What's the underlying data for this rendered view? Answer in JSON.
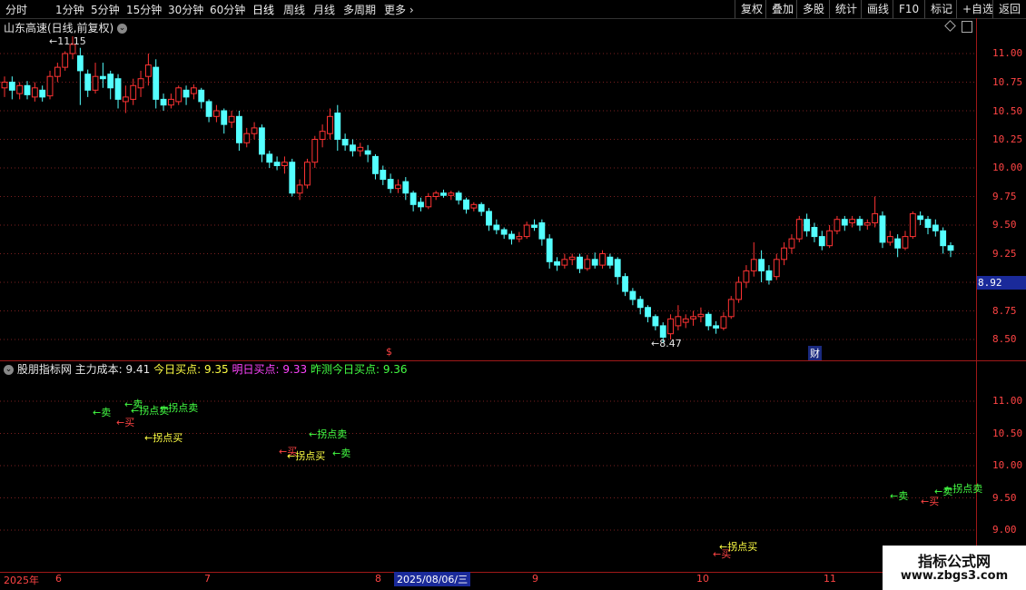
{
  "toolbar": {
    "left": [
      "分时",
      "1分钟",
      "5分钟",
      "15分钟",
      "30分钟",
      "60分钟",
      "日线",
      "周线",
      "月线",
      "多周期",
      "更多"
    ],
    "active": "日线",
    "right": [
      "复权",
      "叠加",
      "多股",
      "统计",
      "画线",
      "F10",
      "标记",
      "+自选",
      "返回"
    ]
  },
  "main_panel": {
    "title": "山东高速(日线,前复权)",
    "high_label": "11.15",
    "low_label": "8.47",
    "current_price": "8.92",
    "marker_dollar": "$",
    "marker_cai": "财",
    "y_ticks": [
      "11.00",
      "10.75",
      "10.50",
      "10.25",
      "10.00",
      "9.75",
      "9.50",
      "9.25",
      "9.00",
      "8.75",
      "8.50"
    ]
  },
  "indicator_panel": {
    "name": "股朋指标网",
    "items": [
      {
        "label": "主力成本:",
        "value": "9.41",
        "color": "#e6e6e6"
      },
      {
        "label": "今日买点:",
        "value": "9.35",
        "color": "#ffff44"
      },
      {
        "label": "明日买点:",
        "value": "9.33",
        "color": "#ff44ff"
      },
      {
        "label": "昨测今日买点:",
        "value": "9.36",
        "color": "#44ff44"
      }
    ],
    "y_ticks": [
      "11.00",
      "10.50",
      "10.00",
      "9.50",
      "9.00"
    ],
    "signals": [
      {
        "text": "←卖",
        "color": "#44ff44"
      },
      {
        "text": "←卖",
        "color": "#44ff44"
      },
      {
        "text": "←拐点卖",
        "color": "#44ff44"
      },
      {
        "text": "←拐点卖",
        "color": "#44ff44"
      },
      {
        "text": "←买",
        "color": "#ff4444"
      },
      {
        "text": "←拐点买",
        "color": "#ffff44"
      },
      {
        "text": "←拐点卖",
        "color": "#44ff44"
      },
      {
        "text": "←买",
        "color": "#ff4444"
      },
      {
        "text": "←拐点买",
        "color": "#ffff44"
      },
      {
        "text": "←卖",
        "color": "#44ff44"
      },
      {
        "text": "←卖",
        "color": "#44ff44"
      },
      {
        "text": "←买",
        "color": "#ff4444"
      },
      {
        "text": "←卖",
        "color": "#44ff44"
      },
      {
        "text": "←拐点卖",
        "color": "#44ff44"
      },
      {
        "text": "←买",
        "color": "#ff4444"
      },
      {
        "text": "←拐点买",
        "color": "#ffff44"
      }
    ]
  },
  "date_axis": {
    "labels": [
      "2025年",
      "6",
      "7",
      "8",
      "9",
      "10",
      "11"
    ],
    "cursor_date": "2025/08/06/三"
  },
  "watermark": {
    "title": "指标公式网",
    "url": "www.zbgs3.com"
  },
  "colors": {
    "up": "#ff3333",
    "down": "#54ffff",
    "grid": "#7a1f1f",
    "axis_text": "#ff4444"
  },
  "chart_data": {
    "type": "candlestick",
    "ylim": [
      8.4,
      11.3
    ],
    "candles": [
      [
        10.7,
        10.75,
        10.62,
        10.8
      ],
      [
        10.75,
        10.68,
        10.6,
        10.8
      ],
      [
        10.65,
        10.72,
        10.6,
        10.75
      ],
      [
        10.72,
        10.64,
        10.6,
        10.76
      ],
      [
        10.62,
        10.7,
        10.58,
        10.75
      ],
      [
        10.68,
        10.62,
        10.58,
        10.72
      ],
      [
        10.63,
        10.8,
        10.6,
        10.85
      ],
      [
        10.8,
        10.88,
        10.75,
        10.92
      ],
      [
        10.88,
        11.0,
        10.85,
        11.02
      ],
      [
        11.0,
        11.08,
        10.95,
        11.15
      ],
      [
        10.98,
        10.85,
        10.55,
        11.05
      ],
      [
        10.82,
        10.68,
        10.62,
        10.86
      ],
      [
        10.68,
        10.8,
        10.65,
        10.92
      ],
      [
        10.8,
        10.78,
        10.7,
        10.92
      ],
      [
        10.82,
        10.7,
        10.6,
        10.85
      ],
      [
        10.78,
        10.6,
        10.52,
        10.82
      ],
      [
        10.58,
        10.62,
        10.48,
        10.72
      ],
      [
        10.6,
        10.72,
        10.55,
        10.78
      ],
      [
        10.7,
        10.78,
        10.62,
        10.85
      ],
      [
        10.8,
        10.9,
        10.72,
        11.0
      ],
      [
        10.88,
        10.6,
        10.52,
        10.95
      ],
      [
        10.6,
        10.55,
        10.5,
        10.65
      ],
      [
        10.55,
        10.6,
        10.52,
        10.65
      ],
      [
        10.58,
        10.7,
        10.55,
        10.72
      ],
      [
        10.68,
        10.62,
        10.55,
        10.72
      ],
      [
        10.65,
        10.7,
        10.6,
        10.73
      ],
      [
        10.68,
        10.58,
        10.52,
        10.7
      ],
      [
        10.58,
        10.45,
        10.4,
        10.6
      ],
      [
        10.45,
        10.5,
        10.4,
        10.55
      ],
      [
        10.5,
        10.38,
        10.3,
        10.52
      ],
      [
        10.4,
        10.45,
        10.35,
        10.5
      ],
      [
        10.45,
        10.22,
        10.15,
        10.5
      ],
      [
        10.22,
        10.3,
        10.18,
        10.35
      ],
      [
        10.3,
        10.35,
        10.25,
        10.4
      ],
      [
        10.35,
        10.12,
        10.05,
        10.38
      ],
      [
        10.12,
        10.05,
        10.0,
        10.15
      ],
      [
        10.05,
        10.02,
        9.98,
        10.1
      ],
      [
        10.02,
        10.05,
        9.95,
        10.1
      ],
      [
        10.05,
        9.78,
        9.75,
        10.08
      ],
      [
        9.78,
        9.85,
        9.72,
        9.9
      ],
      [
        9.85,
        10.05,
        9.82,
        10.08
      ],
      [
        10.05,
        10.25,
        10.0,
        10.28
      ],
      [
        10.25,
        10.32,
        10.18,
        10.38
      ],
      [
        10.3,
        10.45,
        10.25,
        10.52
      ],
      [
        10.48,
        10.25,
        10.15,
        10.55
      ],
      [
        10.25,
        10.2,
        10.15,
        10.3
      ],
      [
        10.2,
        10.15,
        10.1,
        10.25
      ],
      [
        10.15,
        10.18,
        10.1,
        10.22
      ],
      [
        10.15,
        10.12,
        10.05,
        10.2
      ],
      [
        10.1,
        9.95,
        9.9,
        10.12
      ],
      [
        9.98,
        9.9,
        9.85,
        10.02
      ],
      [
        9.9,
        9.82,
        9.78,
        9.95
      ],
      [
        9.82,
        9.85,
        9.78,
        9.9
      ],
      [
        9.88,
        9.78,
        9.72,
        9.92
      ],
      [
        9.78,
        9.68,
        9.62,
        9.8
      ],
      [
        9.7,
        9.66,
        9.62,
        9.74
      ],
      [
        9.66,
        9.75,
        9.64,
        9.78
      ],
      [
        9.75,
        9.78,
        9.72,
        9.8
      ],
      [
        9.78,
        9.76,
        9.74,
        9.81
      ],
      [
        9.76,
        9.78,
        9.72,
        9.8
      ],
      [
        9.78,
        9.72,
        9.68,
        9.8
      ],
      [
        9.72,
        9.64,
        9.6,
        9.74
      ],
      [
        9.65,
        9.68,
        9.62,
        9.7
      ],
      [
        9.68,
        9.62,
        9.58,
        9.7
      ],
      [
        9.62,
        9.5,
        9.45,
        9.65
      ],
      [
        9.5,
        9.46,
        9.42,
        9.55
      ],
      [
        9.46,
        9.42,
        9.38,
        9.48
      ],
      [
        9.42,
        9.38,
        9.33,
        9.45
      ],
      [
        9.38,
        9.4,
        9.35,
        9.44
      ],
      [
        9.4,
        9.5,
        9.38,
        9.53
      ],
      [
        9.5,
        9.48,
        9.45,
        9.55
      ],
      [
        9.52,
        9.38,
        9.32,
        9.55
      ],
      [
        9.38,
        9.18,
        9.12,
        9.42
      ],
      [
        9.18,
        9.15,
        9.1,
        9.22
      ],
      [
        9.15,
        9.2,
        9.12,
        9.25
      ],
      [
        9.2,
        9.22,
        9.15,
        9.25
      ],
      [
        9.22,
        9.12,
        9.08,
        9.25
      ],
      [
        9.12,
        9.2,
        9.1,
        9.24
      ],
      [
        9.2,
        9.15,
        9.12,
        9.26
      ],
      [
        9.15,
        9.25,
        9.12,
        9.28
      ],
      [
        9.22,
        9.15,
        9.12,
        9.25
      ],
      [
        9.2,
        9.05,
        8.98,
        9.22
      ],
      [
        9.05,
        8.92,
        8.88,
        9.08
      ],
      [
        8.92,
        8.85,
        8.8,
        8.95
      ],
      [
        8.85,
        8.78,
        8.72,
        8.88
      ],
      [
        8.78,
        8.7,
        8.65,
        8.8
      ],
      [
        8.7,
        8.62,
        8.58,
        8.72
      ],
      [
        8.62,
        8.52,
        8.47,
        8.65
      ],
      [
        8.55,
        8.68,
        8.5,
        8.72
      ],
      [
        8.62,
        8.7,
        8.58,
        8.8
      ],
      [
        8.65,
        8.68,
        8.6,
        8.72
      ],
      [
        8.68,
        8.7,
        8.62,
        8.75
      ],
      [
        8.7,
        8.72,
        8.65,
        8.78
      ],
      [
        8.72,
        8.62,
        8.58,
        8.74
      ],
      [
        8.62,
        8.6,
        8.55,
        8.66
      ],
      [
        8.6,
        8.7,
        8.58,
        8.74
      ],
      [
        8.7,
        8.85,
        8.68,
        8.88
      ],
      [
        8.85,
        9.0,
        8.82,
        9.05
      ],
      [
        9.0,
        9.1,
        8.95,
        9.15
      ],
      [
        9.1,
        9.2,
        9.05,
        9.35
      ],
      [
        9.2,
        9.1,
        9.0,
        9.28
      ],
      [
        9.1,
        9.02,
        8.98,
        9.15
      ],
      [
        9.05,
        9.2,
        9.02,
        9.25
      ],
      [
        9.2,
        9.3,
        9.15,
        9.35
      ],
      [
        9.3,
        9.38,
        9.25,
        9.42
      ],
      [
        9.38,
        9.55,
        9.35,
        9.58
      ],
      [
        9.55,
        9.45,
        9.4,
        9.6
      ],
      [
        9.48,
        9.4,
        9.35,
        9.52
      ],
      [
        9.4,
        9.32,
        9.28,
        9.45
      ],
      [
        9.32,
        9.45,
        9.3,
        9.5
      ],
      [
        9.45,
        9.55,
        9.42,
        9.58
      ],
      [
        9.55,
        9.5,
        9.45,
        9.58
      ],
      [
        9.52,
        9.55,
        9.48,
        9.58
      ],
      [
        9.55,
        9.5,
        9.45,
        9.58
      ],
      [
        9.5,
        9.52,
        9.46,
        9.55
      ],
      [
        9.52,
        9.6,
        9.48,
        9.75
      ],
      [
        9.58,
        9.35,
        9.3,
        9.62
      ],
      [
        9.35,
        9.4,
        9.32,
        9.45
      ],
      [
        9.38,
        9.3,
        9.22,
        9.42
      ],
      [
        9.3,
        9.4,
        9.28,
        9.45
      ],
      [
        9.4,
        9.6,
        9.38,
        9.62
      ],
      [
        9.58,
        9.55,
        9.5,
        9.62
      ],
      [
        9.55,
        9.48,
        9.42,
        9.58
      ],
      [
        9.5,
        9.45,
        9.4,
        9.55
      ],
      [
        9.45,
        9.32,
        9.25,
        9.48
      ],
      [
        9.32,
        9.28,
        9.22,
        9.35
      ]
    ]
  }
}
